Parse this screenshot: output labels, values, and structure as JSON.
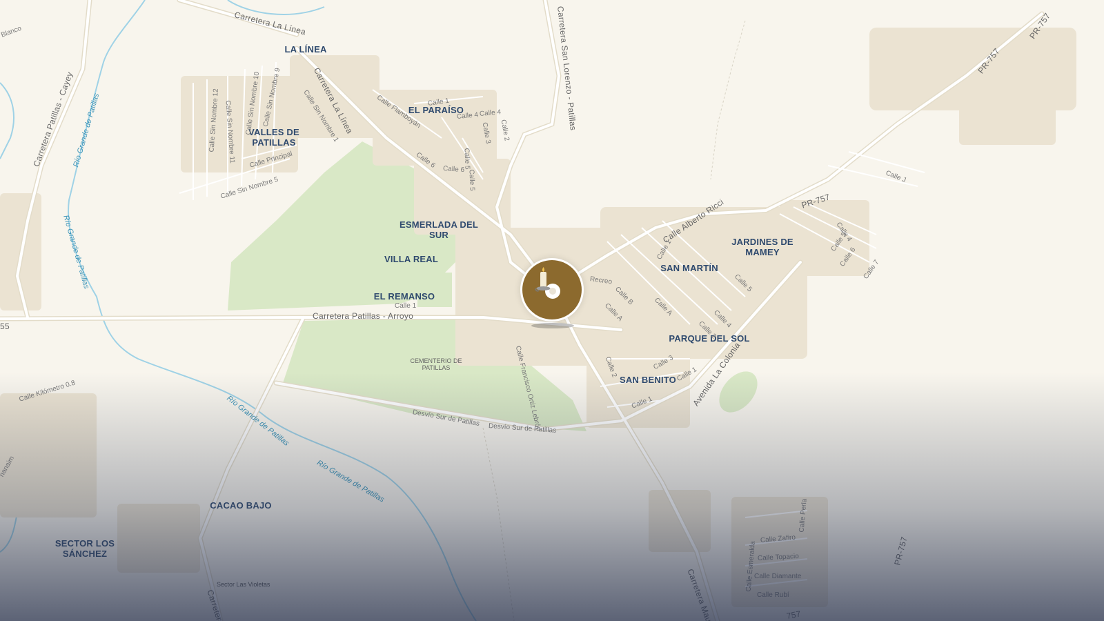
{
  "colors": {
    "land": "#f8f5ed",
    "park": "#d9e8c6",
    "road": "#ffffff",
    "road_casing": "#e6dfcf",
    "building": "#ebe3d2",
    "river": "#9fd2e6",
    "place_label": "#2f4a6e",
    "marker": "#8c6a2e"
  },
  "places": {
    "la_linea": "LA LÍNEA",
    "el_paraiso": "EL PARAÍSO",
    "valles_de_patillas": [
      "VALLES DE",
      "PATILLAS"
    ],
    "esmerlada_del_sur": [
      "ESMERLADA DEL",
      "SUR"
    ],
    "villa_real": "VILLA REAL",
    "el_remanso": "EL REMANSO",
    "san_martin": "SAN MARTÍN",
    "jardines_de_mamey": [
      "JARDINES DE",
      "MAMEY"
    ],
    "parque_del_sol": "PARQUE DEL SOL",
    "san_benito": "SAN BENITO",
    "cacao_bajo": "CACAO BAJO",
    "sector_los_sanchez": [
      "SECTOR LOS",
      "SÁNCHEZ"
    ]
  },
  "pois": {
    "cementerio": [
      "CEMENTERIO DE",
      "PATILLAS"
    ]
  },
  "roads": {
    "carretera_la_linea_top": "Carretera La Línea",
    "carretera_la_linea": "Carretera La Línea",
    "carretera_san_lorenzo": "Carretera San Lorenzo - Patillas",
    "carretera_patillas_cayey": "Carretera Patillas - Cayey",
    "carretera_patillas_arroyo": "Carretera Patillas - Arroyo",
    "pr757_a": "PR-757",
    "pr757_b": "PR-757",
    "pr757_c": "PR-757",
    "pr757_d": "PR-757",
    "calle_alberto_ricci": "Calle Alberto Ricci",
    "avenida_la_colonia": "Avenida La Colonia",
    "desvio_sur_1": "Desvío Sur de Patillas",
    "desvio_sur_2": "Desvío Sur de Patillas",
    "calle_kilometro": "Calle Kilómetro 0.8",
    "calle_principal": "Calle Principal",
    "calle_sin_nombre_5": "Calle Sin Nombre 5",
    "calle_sin_nombre_1": "Calle Sin Nombre 1",
    "calle_sin_nombre_9": "Calle Sin Nombre 9",
    "calle_sin_nombre_10": "Calle Sin Nombre 10",
    "calle_sin_nombre_11": "Calle Sin Nombre 11",
    "calle_sin_nombre_12": "Calle Sin Nombre 12",
    "calle_flamboyan": "Calle Flamboyán",
    "calle_1_paraiso": "Calle 1",
    "calle_4a": "Calle 4",
    "calle_4b": "Calle 4",
    "calle_3_paraiso": "Calle 3",
    "calle_2_paraiso": "Calle 2",
    "calle_6a": "Calle 6",
    "calle_6b": "Calle 6",
    "calle_5a": "Calle 5",
    "calle_5b": "Calle 5",
    "calle_1_remanso": "Calle 1",
    "calle_francisco": "Calle Francisco Ortiz Lebrón",
    "recreo": "Recreo",
    "calle_b": "Calle B",
    "calle_a1": "Calle A",
    "calle_a2": "Calle A",
    "calle_1_sm": "Calle 1",
    "calle_5_sm": "Calle 5",
    "calle_4_sm": "Calle 4",
    "calle_2_sm": "Calle 2",
    "calle_3_sm": "Calle 3",
    "calle_1_pds": "Calle 1",
    "calle_2_sb": "Calle 2",
    "calle_1_sb": "Calle 1",
    "calle_j": "Calle J",
    "calle_4_jm": "Calle 4",
    "calle_5_jm": "Calle 5",
    "calle_6_jm": "Calle 6",
    "calle_7_jm": "Calle 7",
    "calle_zafiro": "Calle Zafiro",
    "calle_topacio": "Calle Topacio",
    "calle_diamante": "Calle Diamante",
    "calle_rubi": "Calle Rubí",
    "calle_perla": "Calle Perla",
    "calle_esmeralda": "Calle Esmeralda",
    "carretera_maunabo": "Carretera Mau",
    "carretera_bottom": "Carretera",
    "sector_las_violetas": "Sector Las Violetas",
    "blanco": "Blanco",
    "num_55": "55",
    "nanaim": "nanaim",
    "pr757_bottom": "757"
  },
  "rivers": {
    "rio_top": "Río Grande de Patillas",
    "rio_left": "Río Grande de Patillas",
    "rio_bottom1": "Río Grande de Patillas",
    "rio_bottom2": "Río Grande de Patillas"
  },
  "marker": {
    "icon": "candle-icon"
  }
}
